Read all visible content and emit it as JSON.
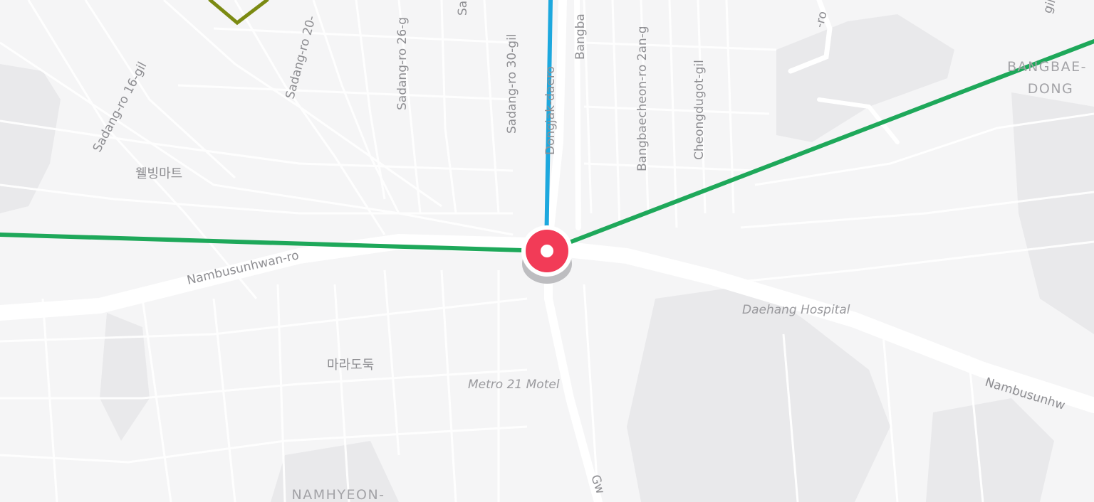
{
  "map": {
    "districts": {
      "bangbae_line1": "BANGBAE-",
      "bangbae_line2": "DONG",
      "namhyeon": "NAMHYEON-"
    },
    "roads": {
      "sadang_16": "Sadang-ro 16-gil",
      "sadang_20": "Sadang-ro 20-",
      "sadang_26": "Sadang-ro 26-g",
      "sadang_sa": "Sa",
      "sadang_30": "Sadang-ro 30-gil",
      "dongjak": "Dongjak-daero",
      "bangba": "Bangba",
      "bangbaecheon": "Bangbaecheon-ro 2an-g",
      "cheongdugot": "Cheongdugot-gil",
      "ro_top": "-ro",
      "gil_top": "gil",
      "nambu_left": "Nambusunhwan-ro",
      "nambu_right": "Nambusunhw",
      "gw": "Gw"
    },
    "pois": {
      "wellbeing": "웰빙마트",
      "marado": "마라도둑",
      "daehang": "Daehang Hospital",
      "metro21": "Metro 21 Motel"
    },
    "colors": {
      "route_green": "#1ea85a",
      "route_blue": "#1da8de",
      "route_olive": "#7b8a12",
      "marker": "#f23b57"
    },
    "marker_icon": "location-pin-icon"
  }
}
